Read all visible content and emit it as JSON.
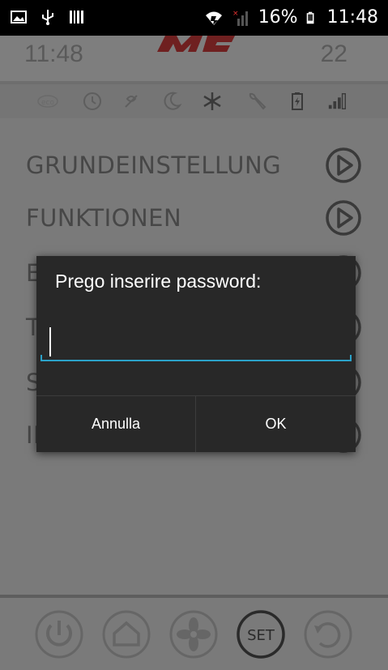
{
  "status_bar": {
    "battery_percent": "16%",
    "time": "11:48",
    "icons": [
      "image-icon",
      "usb-icon",
      "barcode-icon",
      "wifi-icon",
      "signal-icon",
      "battery-icon"
    ]
  },
  "app": {
    "header_left": "11:48",
    "header_right": "22",
    "logo": "MCZ",
    "icon_bar": [
      "eco-icon",
      "clock-icon",
      "no-fan-icon",
      "moon-icon",
      "snowflake-icon",
      "wrench-icon",
      "battery-charge-icon",
      "signal-bars-icon"
    ],
    "menu_items": [
      {
        "label": "GRUNDEINSTELLUNG"
      },
      {
        "label": "FUNKTIONEN"
      },
      {
        "label": "E"
      },
      {
        "label": "T"
      },
      {
        "label": "S"
      },
      {
        "label": "IN"
      }
    ],
    "bottom_nav": [
      "power-icon",
      "home-icon",
      "fan-icon",
      "set-button",
      "refresh-icon"
    ],
    "set_label": "SET"
  },
  "dialog": {
    "title": "Prego inserire password:",
    "input_value": "",
    "cancel_label": "Annulla",
    "ok_label": "OK",
    "accent_color": "#2ba2c9"
  }
}
